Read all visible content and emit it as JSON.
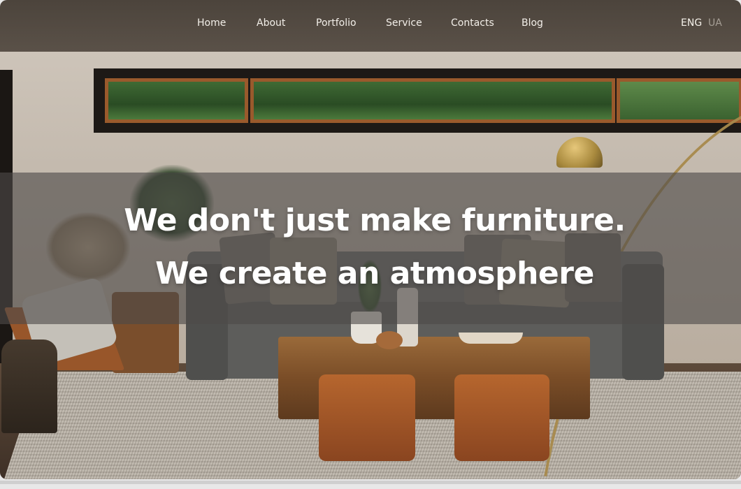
{
  "nav": {
    "items": [
      "Home",
      "About",
      "Portfolio",
      "Service",
      "Contacts",
      "Blog"
    ],
    "languages": [
      "ENG",
      "UA"
    ],
    "active_language": "ENG"
  },
  "hero": {
    "line1": "We don't just make furniture.",
    "line2": "We create an atmosphere"
  },
  "colors": {
    "topbar": "#4c443c",
    "nav_text": "#f3efe9",
    "inactive_lang": "#a69f96",
    "hero_text": "#ffffff",
    "hero_band": "rgba(78,74,72,0.62)"
  }
}
